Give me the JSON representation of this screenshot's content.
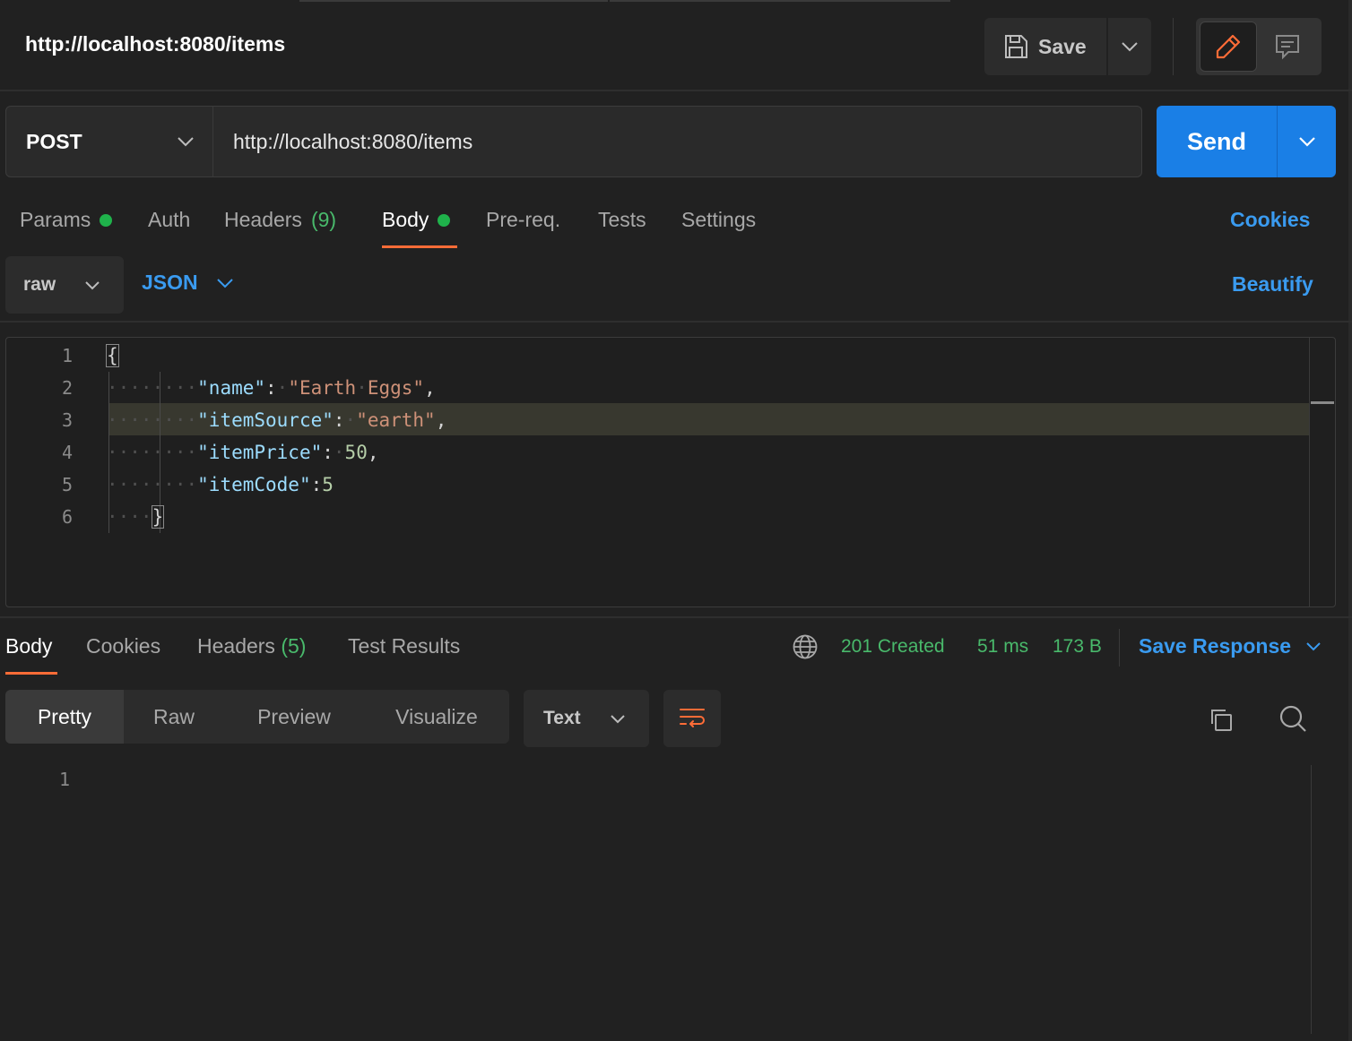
{
  "header": {
    "title": "http://localhost:8080/items",
    "save_label": "Save"
  },
  "request": {
    "method": "POST",
    "url": "http://localhost:8080/items",
    "send_label": "Send"
  },
  "request_tabs": [
    {
      "label": "Params",
      "dot": true
    },
    {
      "label": "Auth"
    },
    {
      "label": "Headers",
      "count": "(9)"
    },
    {
      "label": "Body",
      "dot": true,
      "active": true
    },
    {
      "label": "Pre-req."
    },
    {
      "label": "Tests"
    },
    {
      "label": "Settings"
    }
  ],
  "cookies_label": "Cookies",
  "body_format": {
    "mode": "raw",
    "language": "JSON",
    "beautify_label": "Beautify"
  },
  "editor": {
    "line_numbers": [
      "1",
      "2",
      "3",
      "4",
      "5",
      "6"
    ],
    "lines": [
      "{",
      "        \"name\": \"Earth Eggs\",",
      "        \"itemSource\": \"earth\",",
      "        \"itemPrice\": 50,",
      "        \"itemCode\":5",
      "    }"
    ]
  },
  "response_tabs": [
    {
      "label": "Body",
      "active": true
    },
    {
      "label": "Cookies"
    },
    {
      "label": "Headers",
      "count": "(5)"
    },
    {
      "label": "Test Results"
    }
  ],
  "response_status": {
    "status": "201 Created",
    "time": "51 ms",
    "size": "173 B"
  },
  "save_response_label": "Save Response",
  "response_views": [
    "Pretty",
    "Raw",
    "Preview",
    "Visualize"
  ],
  "response_format": "Text",
  "response_body": {
    "line_numbers": [
      "1"
    ]
  },
  "colors": {
    "accent_orange": "#ff6c37",
    "primary_blue": "#1a7fe6",
    "link_blue": "#3a9bf0",
    "success_green": "#49b96b",
    "dot_green": "#1fb24b"
  },
  "icons": {
    "save": "floppy-disk-icon",
    "edit": "pencil-icon",
    "comment": "comment-icon",
    "globe": "globe-icon",
    "wrap": "word-wrap-icon",
    "copy": "copy-icon",
    "search": "search-icon",
    "chevron": "chevron-down-icon"
  }
}
